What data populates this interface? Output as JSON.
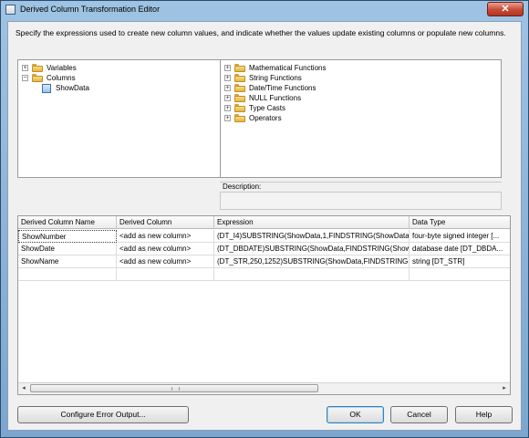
{
  "window": {
    "title": "Derived Column Transformation Editor",
    "close_glyph": "✕"
  },
  "instructions": "Specify the expressions used to create new column values, and indicate whether the values update existing columns or populate new columns.",
  "left_tree": {
    "items": [
      {
        "label": "Variables",
        "expander": "+",
        "icon": "folder-icon"
      },
      {
        "label": "Columns",
        "expander": "−",
        "icon": "folder-icon"
      },
      {
        "label": "ShowData",
        "expander": "",
        "icon": "column-icon"
      }
    ]
  },
  "right_tree": {
    "items": [
      {
        "label": "Mathematical Functions",
        "expander": "+"
      },
      {
        "label": "String Functions",
        "expander": "+"
      },
      {
        "label": "Date/Time Functions",
        "expander": "+"
      },
      {
        "label": "NULL Functions",
        "expander": "+"
      },
      {
        "label": "Type Casts",
        "expander": "+"
      },
      {
        "label": "Operators",
        "expander": "+"
      }
    ]
  },
  "description": {
    "label": "Description:",
    "text": ""
  },
  "grid": {
    "columns": [
      "Derived Column Name",
      "Derived Column",
      "Expression",
      "Data Type"
    ],
    "rows": [
      [
        "ShowNumber",
        "<add as new column>",
        "(DT_I4)SUBSTRING(ShowData,1,FINDSTRING(ShowData,...",
        "four-byte signed integer [..."
      ],
      [
        "ShowDate",
        "<add as new column>",
        "(DT_DBDATE)SUBSTRING(ShowData,FINDSTRING(Show...",
        "database date [DT_DBDA..."
      ],
      [
        "ShowName",
        "<add as new column>",
        "(DT_STR,250,1252)SUBSTRING(ShowData,FINDSTRING(S...",
        "string [DT_STR]"
      ]
    ],
    "scroll_left": "◂",
    "scroll_right": "▸"
  },
  "buttons": {
    "configure_error_output": "Configure Error Output...",
    "ok": "OK",
    "cancel": "Cancel",
    "help": "Help"
  }
}
